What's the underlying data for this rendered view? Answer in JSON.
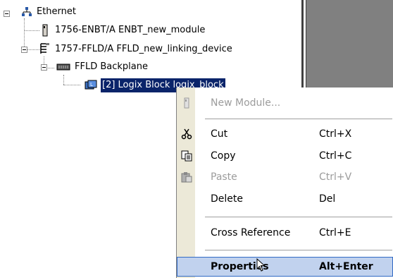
{
  "tree": {
    "root": {
      "label": "Ethernet",
      "icon": "network-icon"
    },
    "items": [
      {
        "label": "1756-ENBT/A ENBT_new_module",
        "icon": "module-icon"
      },
      {
        "label": "1757-FFLD/A FFLD_new_linking_device",
        "icon": "linking-device-icon"
      },
      {
        "label": "FFLD Backplane",
        "icon": "backplane-icon"
      },
      {
        "label": "[2] Logix Block logix_block",
        "icon": "logix-block-icon",
        "selected": true
      }
    ]
  },
  "context_menu": {
    "items": [
      {
        "label": "New Module...",
        "shortcut": "",
        "disabled": true,
        "icon": "module-icon"
      },
      {
        "label": "Cut",
        "shortcut": "Ctrl+X",
        "disabled": false,
        "icon": "scissors-icon"
      },
      {
        "label": "Copy",
        "shortcut": "Ctrl+C",
        "disabled": false,
        "icon": "copy-icon"
      },
      {
        "label": "Paste",
        "shortcut": "Ctrl+V",
        "disabled": true,
        "icon": "paste-icon"
      },
      {
        "label": "Delete",
        "shortcut": "Del",
        "disabled": false,
        "icon": ""
      },
      {
        "label": "Cross Reference",
        "shortcut": "Ctrl+E",
        "disabled": false,
        "icon": ""
      },
      {
        "label": "Properties",
        "shortcut": "Alt+Enter",
        "disabled": false,
        "icon": "",
        "highlighted": true
      }
    ]
  },
  "colors": {
    "selection": "#0a246a",
    "menu_highlight": "#c1d2ee",
    "menu_gutter": "#ece9d8",
    "right_pane": "#808080"
  }
}
